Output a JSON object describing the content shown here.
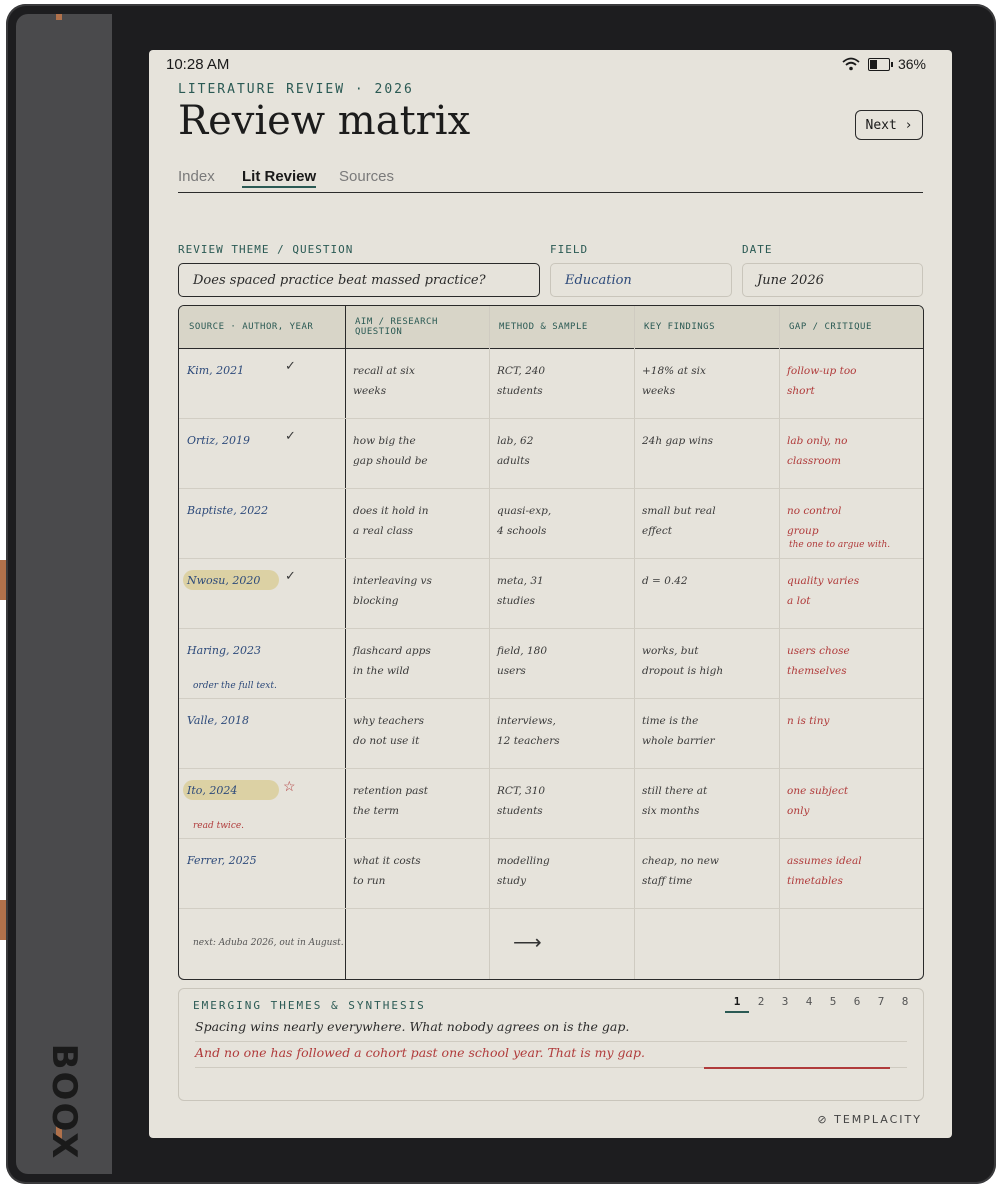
{
  "status": {
    "time": "10:28 AM",
    "battery": "36%",
    "battery_level": 0.36
  },
  "header": {
    "eyebrow": "LITERATURE REVIEW · 2026",
    "title": "Review matrix",
    "next_label": "Next ›"
  },
  "tabs": [
    {
      "label": "Index"
    },
    {
      "label": "Lit Review"
    },
    {
      "label": "Sources"
    }
  ],
  "form": {
    "theme_label": "REVIEW THEME / QUESTION",
    "theme_value": "Does spaced practice beat massed practice?",
    "field_label": "FIELD",
    "field_value": "Education",
    "date_label": "DATE",
    "date_value": "June 2026"
  },
  "matrix": {
    "headers": [
      "SOURCE · AUTHOR, YEAR",
      "AIM / RESEARCH QUESTION",
      "METHOD & SAMPLE",
      "KEY FINDINGS",
      "GAP / CRITIQUE"
    ],
    "rows": [
      {
        "source": "Kim, 2021",
        "aim": "recall at six\nweeks",
        "method": "RCT, 240\nstudents",
        "findings": "+18% at six\nweeks",
        "gap": "follow-up too\nshort",
        "check": "✓"
      },
      {
        "source": "Ortiz, 2019",
        "aim": "how big the\ngap should be",
        "method": "lab, 62\nadults",
        "findings": "24h gap wins",
        "gap": "lab only, no\nclassroom",
        "check": "✓"
      },
      {
        "source": "Baptiste, 2022",
        "aim": "does it hold in\na real class",
        "method": "quasi-exp,\n4 schools",
        "findings": "small but real\neffect",
        "gap": "no control\ngroup",
        "note": "the one to argue with."
      },
      {
        "source": "Nwosu, 2020",
        "aim": "interleaving vs\nblocking",
        "method": "meta, 31\nstudies",
        "findings": "d = 0.42",
        "gap": "quality varies\na lot",
        "check": "✓"
      },
      {
        "source": "Haring, 2023",
        "aim": "flashcard apps\nin the wild",
        "method": "field, 180\nusers",
        "findings": "works, but\ndropout is high",
        "gap": "users chose\nthemselves",
        "note": "order the full text."
      },
      {
        "source": "Valle, 2018",
        "aim": "why teachers\ndo not use it",
        "method": "interviews,\n12 teachers",
        "findings": "time is the\nwhole barrier",
        "gap": "n is tiny"
      },
      {
        "source": "Ito, 2024",
        "aim": "retention past\nthe term",
        "method": "RCT, 310\nstudents",
        "findings": "still there at\nsix months",
        "gap": "one subject\nonly",
        "star": "☆",
        "note": "read twice."
      },
      {
        "source": "Ferrer, 2025",
        "aim": "what it costs\nto run",
        "method": "modelling\nstudy",
        "findings": "cheap, no new\nstaff time",
        "gap": "assumes ideal\ntimetables"
      }
    ],
    "last_note": "next: Aduba 2026, out in August.",
    "last_arrow": "⟶"
  },
  "synthesis": {
    "title": "EMERGING THEMES & SYNTHESIS",
    "pages": [
      "1",
      "2",
      "3",
      "4",
      "5",
      "6",
      "7",
      "8"
    ],
    "line1": "Spacing wins nearly everywhere. What nobody agrees on is the gap.",
    "line2": "And no one has followed a cohort past one school year. That is my gap."
  },
  "device": {
    "brand": "BOOX"
  },
  "footer": {
    "brand": "TEMPLACITY",
    "logo": "⊘"
  },
  "icons": {
    "wifi": "wifi-icon",
    "battery": "battery-icon",
    "check": "check-icon",
    "star": "star-icon",
    "arrow": "arrow-right-icon"
  },
  "colors": {
    "accent": "#2b5a54",
    "ink_blue": "#2d4a7a",
    "ink_red": "#b03b3b",
    "highlight": "#dcd1a4",
    "paper": "#e6e3db"
  }
}
